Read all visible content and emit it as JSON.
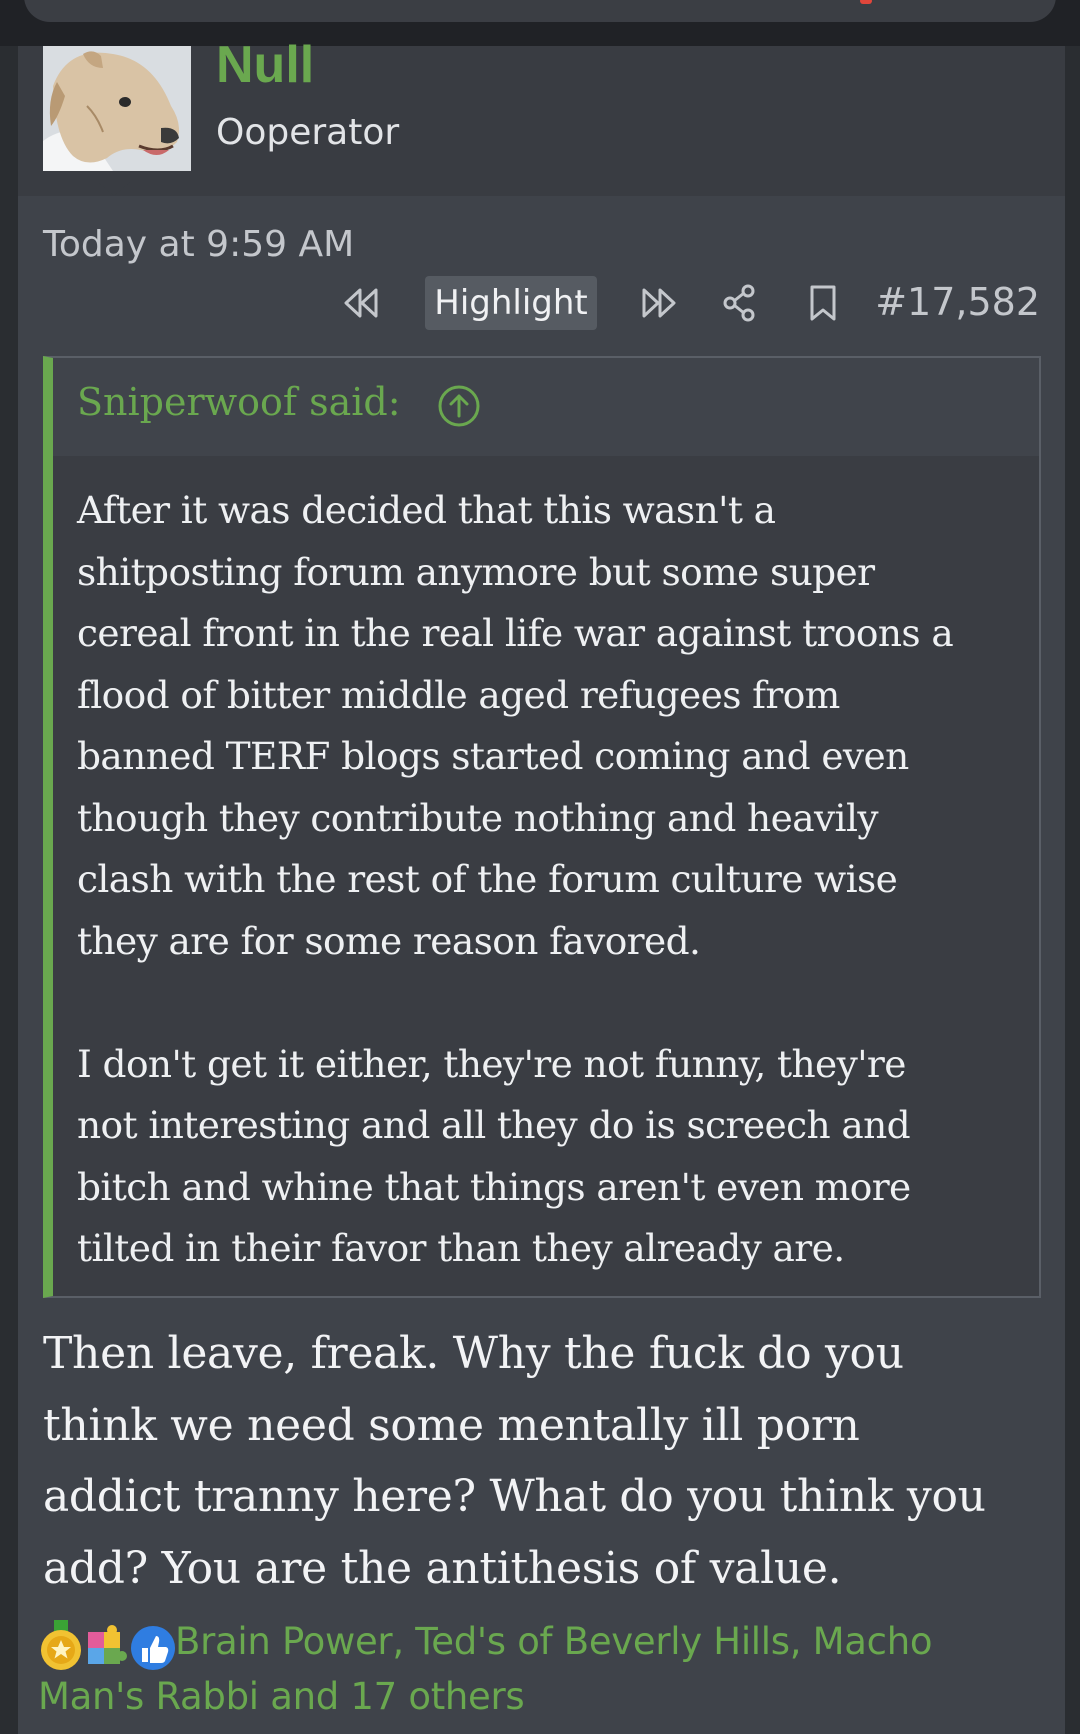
{
  "post": {
    "username": "Null",
    "user_title": "Ooperator",
    "timestamp": "Today at 9:59 AM",
    "highlight_label": "Highlight",
    "post_number": "#17,582"
  },
  "quote": {
    "author": "Sniperwoof said:",
    "paragraphs": [
      "After it was decided that this wasn't a\nshitposting forum anymore but some super\ncereal front in the real life war against troons a\nflood of bitter middle aged refugees from\nbanned TERF blogs started coming and even\nthough they contribute nothing and heavily\nclash with the rest of the forum culture wise\nthey are for some reason favored.",
      "I don't get it either, they're not funny, they're\nnot interesting and all they do is screech and\nbitch and whine that things aren't even more\ntilted in their favor than they already are."
    ]
  },
  "reply": {
    "text": "Then leave, freak. Why the fuck do you\nthink we need some mentally ill porn\naddict tranny here? What do you think you\nadd? You are the antithesis of value."
  },
  "reactions": {
    "text": "Brain Power, Ted's of Beverly Hills, Macho Man's Rabbi and 17 others",
    "icons": [
      "medal-icon",
      "puzzle-icon",
      "thumbs-up-icon"
    ]
  },
  "colors": {
    "accent_green": "#6aa84f",
    "post_background": "#3f434a",
    "quote_background": "#3a3d43"
  }
}
